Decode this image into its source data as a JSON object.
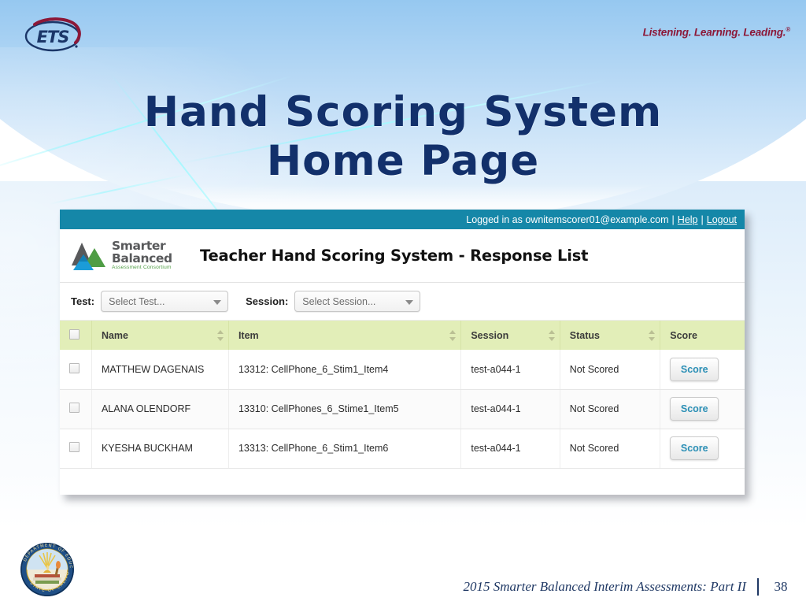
{
  "brand": {
    "logo_text": "ETS",
    "tagline": "Listening. Learning. Leading.",
    "tagline_mark": "®",
    "logo_color": "#1b3668",
    "swoosh_color": "#8c1838",
    "tagline_color": "#8c1838"
  },
  "slide": {
    "title_line1": "Hand Scoring System",
    "title_line2": "Home Page",
    "title_color": "#12306b",
    "banner_color": "#5aa6e4"
  },
  "app": {
    "topbar": {
      "logged_in_text": "Logged in as ownitemscorer01@example.com",
      "separator": "|",
      "help_label": "Help",
      "logout_label": "Logout",
      "background": "#1587a8"
    },
    "header": {
      "org_logo_line1": "Smarter",
      "org_logo_line2": "Balanced",
      "org_logo_line3": "Assessment Consortium",
      "title": "Teacher Hand Scoring System - Response List"
    },
    "filters": {
      "test_label": "Test:",
      "test_value": "Select Test...",
      "session_label": "Session:",
      "session_value": "Select Session..."
    },
    "table": {
      "header_background": "#e2eeb8",
      "columns": [
        "",
        "Name",
        "Item",
        "Session",
        "Status",
        "Score"
      ],
      "rows": [
        {
          "name": "MATTHEW DAGENAIS",
          "item": "13312: CellPhone_6_Stim1_Item4",
          "session": "test-a044-1",
          "status": "Not Scored",
          "score_label": "Score"
        },
        {
          "name": "ALANA OLENDORF",
          "item": "13310: CellPhones_6_Stime1_Item5",
          "session": "test-a044-1",
          "status": "Not Scored",
          "score_label": "Score"
        },
        {
          "name": "KYESHA BUCKHAM",
          "item": "13313: CellPhone_6_Stim1_Item6",
          "session": "test-a044-1",
          "status": "Not Scored",
          "score_label": "Score"
        }
      ]
    }
  },
  "seal": {
    "top_text": "DEPARTMENT OF EDUCATION",
    "bottom_text": "STATE OF CALIFORNIA"
  },
  "footer": {
    "text": "2015 Smarter Balanced Interim Assessments: Part II",
    "page_number": "38"
  }
}
